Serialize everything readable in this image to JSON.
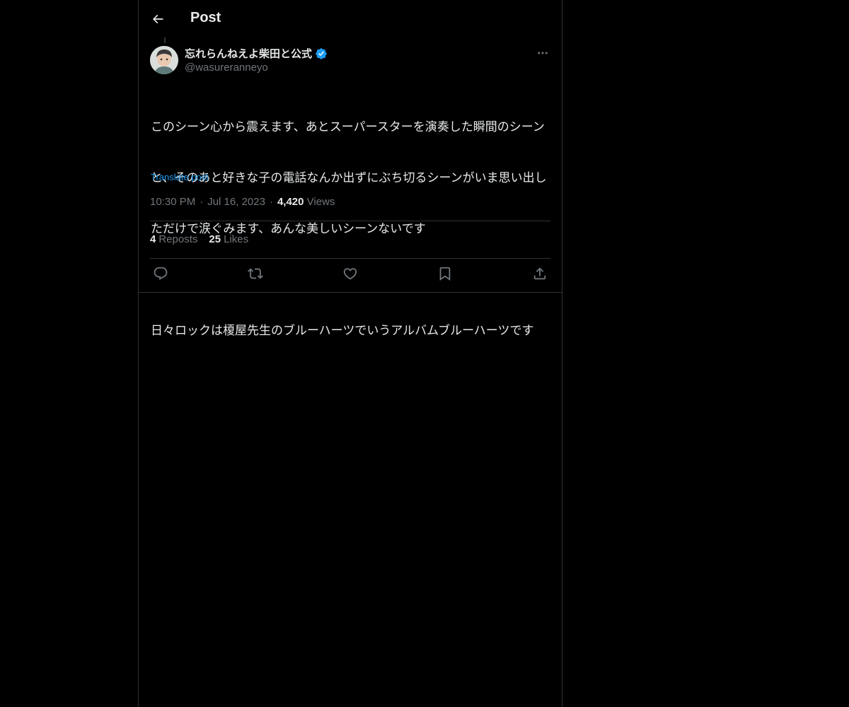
{
  "header": {
    "title": "Post"
  },
  "author": {
    "display_name": "忘れらんねえよ柴田と公式",
    "handle": "@wasureranneyo",
    "verified": true,
    "verified_color": "#1d9bf0"
  },
  "post": {
    "text_lines": [
      "このシーン心から震えます、あとスーパースターを演奏した瞬間のシーン",
      "と、そのあと好きな子の電話なんか出ずにぶち切るシーンがいま思い出し",
      "ただけで涙ぐみます、あんな美しいシーンないです",
      "",
      "日々ロックは榎屋先生のブルーハーツでいうアルバムブルーハーツです"
    ],
    "translate_label": "Translate post",
    "time": "10:30 PM",
    "separator": "·",
    "date": "Jul 16, 2023",
    "views_count": "4,420",
    "views_label": "Views"
  },
  "stats": {
    "reposts_count": "4",
    "reposts_label": "Reposts",
    "likes_count": "25",
    "likes_label": "Likes"
  },
  "actions": [
    "reply-icon",
    "repost-icon",
    "like-icon",
    "bookmark-icon",
    "share-icon"
  ],
  "colors": {
    "background": "#000000",
    "text": "#e7e9ea",
    "muted": "#71767b",
    "accent": "#1d9bf0",
    "border": "#2f3336"
  }
}
